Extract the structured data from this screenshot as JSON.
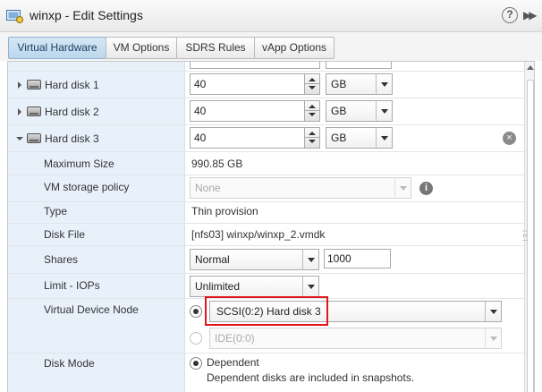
{
  "window": {
    "title": "winxp - Edit Settings",
    "help_label": "?",
    "expand_label": "▶▶"
  },
  "tabs": [
    {
      "label": "Virtual Hardware",
      "active": true
    },
    {
      "label": "VM Options",
      "active": false
    },
    {
      "label": "SDRS Rules",
      "active": false
    },
    {
      "label": "vApp Options",
      "active": false
    }
  ],
  "rows": {
    "hard_disk_1": {
      "label": "Hard disk 1",
      "size": "40",
      "unit": "GB"
    },
    "hard_disk_2": {
      "label": "Hard disk 2",
      "size": "40",
      "unit": "GB"
    },
    "hard_disk_3": {
      "label": "Hard disk 3",
      "size": "40",
      "unit": "GB"
    },
    "maximum_size": {
      "label": "Maximum Size",
      "value": "990.85 GB"
    },
    "storage_policy": {
      "label": "VM storage policy",
      "value": "None",
      "info": "i"
    },
    "type": {
      "label": "Type",
      "value": "Thin provision"
    },
    "disk_file": {
      "label": "Disk File",
      "value": "[nfs03] winxp/winxp_2.vmdk"
    },
    "shares": {
      "label": "Shares",
      "level": "Normal",
      "value": "1000"
    },
    "limit_iops": {
      "label": "Limit - IOPs",
      "value": "Unlimited"
    },
    "virtual_device_node": {
      "label": "Virtual Device Node",
      "scsi_value": "SCSI(0:2) Hard disk 3",
      "ide_value": "IDE(0:0)"
    },
    "disk_mode": {
      "label": "Disk Mode",
      "value": "Dependent",
      "description": "Dependent disks are included in snapshots."
    }
  },
  "remove_label": "×"
}
